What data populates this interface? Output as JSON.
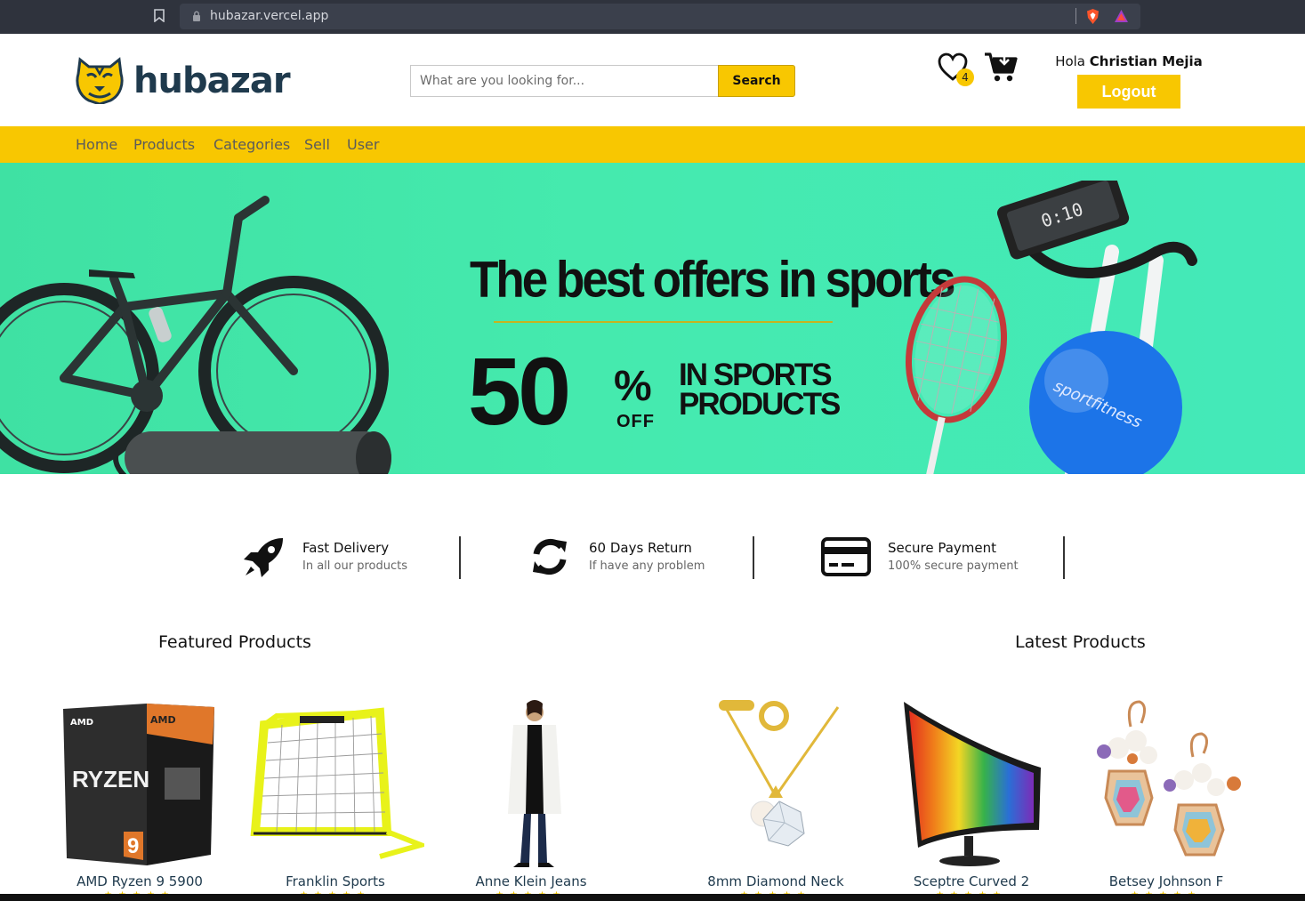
{
  "browser": {
    "url": "hubazar.vercel.app"
  },
  "header": {
    "brand": "hubazar",
    "search_placeholder": "What are you looking for...",
    "search_button": "Search",
    "wishlist_count": "4",
    "greeting": "Hola",
    "user_name": "Christian Mejia",
    "logout_label": "Logout"
  },
  "nav": {
    "items": [
      "Home",
      "Products",
      "Categories",
      "Sell",
      "User"
    ]
  },
  "hero": {
    "title": "The best offers in sports",
    "percent": "50",
    "percent_sign": "%",
    "off": "OFF",
    "in_sports": "IN SPORTS",
    "products": "PRODUCTS",
    "ball_text": "sportfitness"
  },
  "features": [
    {
      "title": "Fast Delivery",
      "subtitle": "In all our products",
      "icon": "rocket-icon"
    },
    {
      "title": "60 Days Return",
      "subtitle": "If have any problem",
      "icon": "refresh-icon"
    },
    {
      "title": "Secure Payment",
      "subtitle": "100% secure payment",
      "icon": "credit-card-icon"
    }
  ],
  "sections": {
    "featured": "Featured Products",
    "latest": "Latest Products"
  },
  "products": [
    {
      "name": "AMD Ryzen 9 5900",
      "stars": "★★★★★"
    },
    {
      "name": "Franklin Sports",
      "stars": "★★★★★"
    },
    {
      "name": "Anne Klein Jeans",
      "stars": "★★★★★"
    },
    {
      "name": "8mm Diamond Neck",
      "stars": "★★★★★"
    },
    {
      "name": "Sceptre Curved 2",
      "stars": "★★★★★"
    },
    {
      "name": "Betsey Johnson F",
      "stars": "★★★★★"
    }
  ],
  "colors": {
    "accent": "#f8c701",
    "brand_text": "#1f3a4d",
    "hero_bg": "#44e9b0"
  }
}
